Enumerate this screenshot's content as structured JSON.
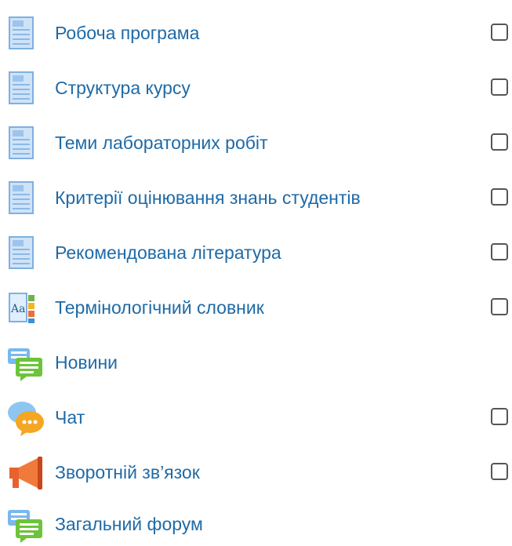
{
  "items": [
    {
      "label": "Робоча програма",
      "icon": "page-icon",
      "has_checkbox": true,
      "checked": false
    },
    {
      "label": "Структура курсу",
      "icon": "page-icon",
      "has_checkbox": true,
      "checked": false
    },
    {
      "label": "Теми лабораторних робіт",
      "icon": "page-icon",
      "has_checkbox": true,
      "checked": false
    },
    {
      "label": "Критерії оцінювання знань студентів",
      "icon": "page-icon",
      "has_checkbox": true,
      "checked": false
    },
    {
      "label": "Рекомендована література",
      "icon": "page-icon",
      "has_checkbox": true,
      "checked": false
    },
    {
      "label": "Термінологічний словник",
      "icon": "glossary-icon",
      "has_checkbox": true,
      "checked": false
    },
    {
      "label": "Новини",
      "icon": "forum-icon",
      "has_checkbox": false,
      "checked": false
    },
    {
      "label": "Чат",
      "icon": "chat-icon",
      "has_checkbox": true,
      "checked": false
    },
    {
      "label": "Зворотній зв’язок",
      "icon": "feedback-megaphone-icon",
      "has_checkbox": true,
      "checked": false
    },
    {
      "label": "Загальний форум",
      "icon": "forum-icon",
      "has_checkbox": false,
      "checked": false
    }
  ],
  "colors": {
    "link": "#1f6aa6",
    "checkbox_border": "#555555"
  }
}
